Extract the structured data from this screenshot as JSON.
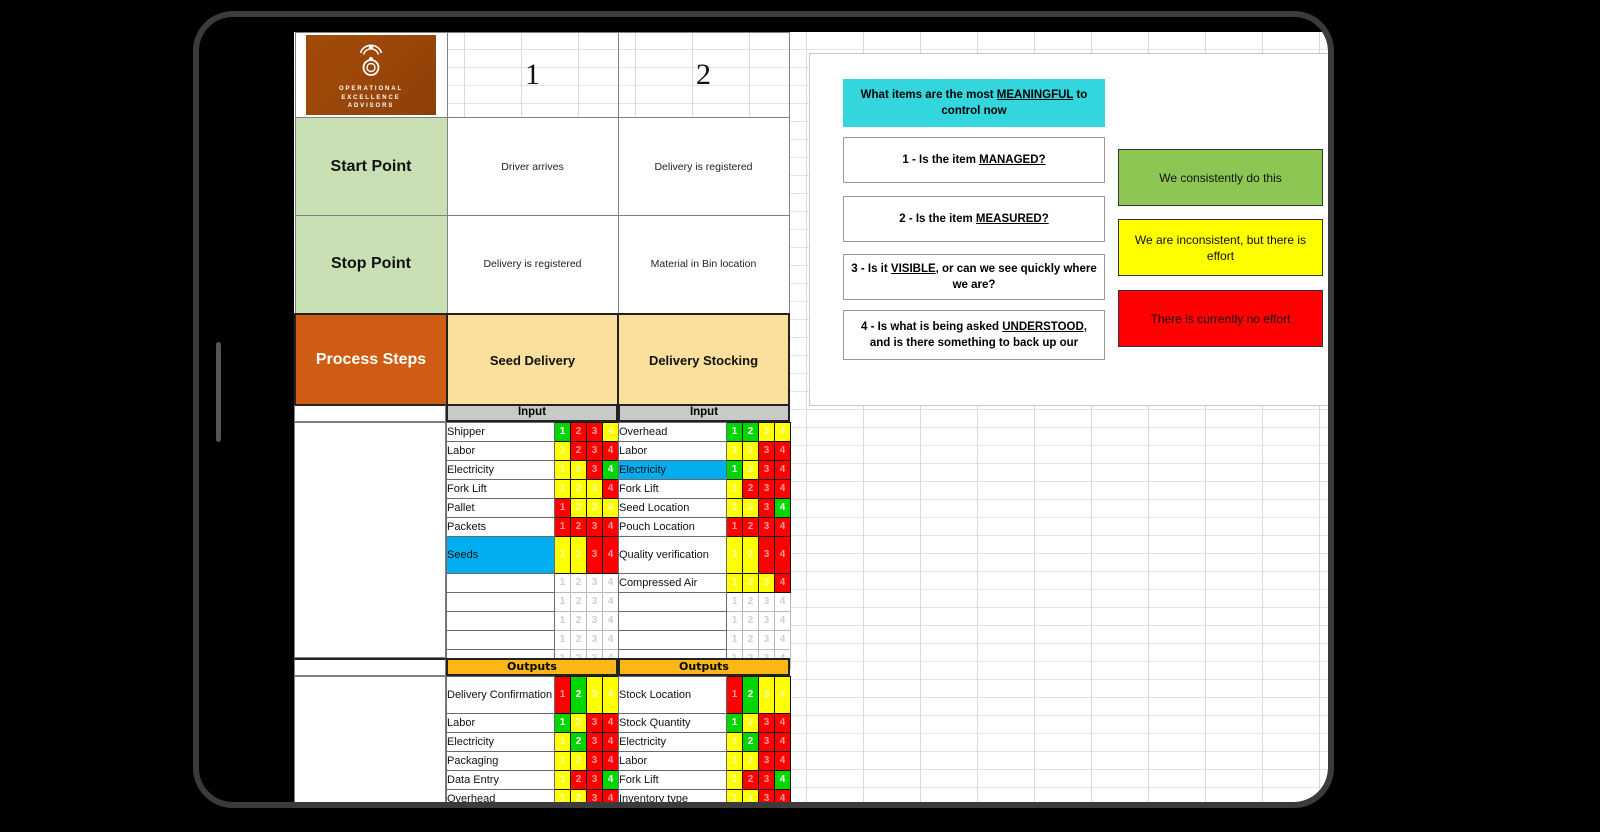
{
  "matrix": {
    "logo": {
      "line1": "OPERATIONAL",
      "line2": "EXCELLENCE",
      "line3": "ADVISORS",
      "icon": "concentric-circles-logo-icon",
      "bg_color": "#9b4709"
    },
    "column_numbers": [
      "1",
      "2"
    ],
    "rows": [
      {
        "label": "Start Point",
        "label_color": "#c9dfb4",
        "values": [
          "Driver arrives",
          "Delivery is registered"
        ]
      },
      {
        "label": "Stop Point",
        "label_color": "#c9dfb4",
        "values": [
          "Delivery is registered",
          "Material in Bin location"
        ]
      },
      {
        "label": "Process Steps",
        "label_color": "#ce5c12",
        "values": [
          "Seed Delivery",
          "Delivery Stocking"
        ]
      }
    ]
  },
  "sections": [
    {
      "header": "Input",
      "header_color": "#c9c9c9",
      "columns": [
        {
          "items": [
            {
              "name": "Shipper",
              "selected": false,
              "scores": [
                "g",
                "r",
                "r",
                "y"
              ]
            },
            {
              "name": "Labor",
              "selected": false,
              "scores": [
                "y",
                "r",
                "r",
                "r"
              ]
            },
            {
              "name": "Electricity",
              "selected": false,
              "scores": [
                "y",
                "y",
                "r",
                "g"
              ]
            },
            {
              "name": "Fork Lift",
              "selected": false,
              "scores": [
                "y",
                "y",
                "y",
                "r"
              ]
            },
            {
              "name": "Pallet",
              "selected": false,
              "scores": [
                "r",
                "y",
                "y",
                "y"
              ]
            },
            {
              "name": "Packets",
              "selected": false,
              "scores": [
                "r",
                "r",
                "r",
                "r"
              ]
            },
            {
              "name": "Seeds",
              "selected": true,
              "tall": true,
              "scores": [
                "y",
                "y",
                "r",
                "r"
              ]
            },
            {
              "name": "",
              "selected": false,
              "scores": [
                "n",
                "n",
                "n",
                "n"
              ]
            },
            {
              "name": "",
              "selected": false,
              "scores": [
                "n",
                "n",
                "n",
                "n"
              ]
            },
            {
              "name": "",
              "selected": false,
              "scores": [
                "n",
                "n",
                "n",
                "n"
              ]
            },
            {
              "name": "",
              "selected": false,
              "scores": [
                "n",
                "n",
                "n",
                "n"
              ]
            },
            {
              "name": "",
              "selected": false,
              "scores": [
                "n",
                "n",
                "n",
                "n"
              ]
            }
          ]
        },
        {
          "items": [
            {
              "name": "Overhead",
              "selected": false,
              "scores": [
                "g",
                "g",
                "y",
                "y"
              ]
            },
            {
              "name": "Labor",
              "selected": false,
              "scores": [
                "y",
                "y",
                "r",
                "r"
              ]
            },
            {
              "name": "Electricity",
              "selected": true,
              "scores": [
                "g",
                "y",
                "r",
                "r"
              ]
            },
            {
              "name": "Fork Lift",
              "selected": false,
              "scores": [
                "y",
                "r",
                "r",
                "r"
              ]
            },
            {
              "name": "Seed Location",
              "selected": false,
              "scores": [
                "y",
                "y",
                "r",
                "g"
              ]
            },
            {
              "name": "Pouch Location",
              "selected": false,
              "scores": [
                "r",
                "r",
                "r",
                "r"
              ]
            },
            {
              "name": "Quality verification",
              "selected": false,
              "tall": true,
              "scores": [
                "y",
                "y",
                "r",
                "r"
              ]
            },
            {
              "name": "Compressed Air",
              "selected": false,
              "scores": [
                "y",
                "y",
                "y",
                "r"
              ]
            },
            {
              "name": "",
              "selected": false,
              "scores": [
                "n",
                "n",
                "n",
                "n"
              ]
            },
            {
              "name": "",
              "selected": false,
              "scores": [
                "n",
                "n",
                "n",
                "n"
              ]
            },
            {
              "name": "",
              "selected": false,
              "scores": [
                "n",
                "n",
                "n",
                "n"
              ]
            },
            {
              "name": "",
              "selected": false,
              "scores": [
                "n",
                "n",
                "n",
                "n"
              ]
            }
          ]
        }
      ]
    },
    {
      "header": "Outputs",
      "header_color": "#fbb715",
      "columns": [
        {
          "items": [
            {
              "name": "Delivery Confirmation",
              "selected": false,
              "tall": true,
              "scores": [
                "r",
                "g",
                "y",
                "y"
              ]
            },
            {
              "name": "Labor",
              "selected": false,
              "scores": [
                "g",
                "y",
                "r",
                "r"
              ]
            },
            {
              "name": "Electricity",
              "selected": false,
              "scores": [
                "y",
                "g",
                "r",
                "r"
              ]
            },
            {
              "name": "Packaging",
              "selected": false,
              "scores": [
                "y",
                "y",
                "r",
                "r"
              ]
            },
            {
              "name": "Data Entry",
              "selected": false,
              "scores": [
                "y",
                "r",
                "r",
                "g"
              ]
            },
            {
              "name": "Overhead",
              "selected": false,
              "scores": [
                "y",
                "y",
                "r",
                "r"
              ]
            }
          ]
        },
        {
          "items": [
            {
              "name": "Stock Location",
              "selected": false,
              "tall": true,
              "scores": [
                "r",
                "g",
                "y",
                "y"
              ]
            },
            {
              "name": "Stock Quantity",
              "selected": false,
              "scores": [
                "g",
                "y",
                "r",
                "r"
              ]
            },
            {
              "name": "Electricity",
              "selected": false,
              "scores": [
                "y",
                "g",
                "r",
                "r"
              ]
            },
            {
              "name": "Labor",
              "selected": false,
              "scores": [
                "y",
                "y",
                "r",
                "r"
              ]
            },
            {
              "name": "Fork Lift",
              "selected": false,
              "scores": [
                "y",
                "r",
                "r",
                "g"
              ]
            },
            {
              "name": "Inventory type",
              "selected": false,
              "scores": [
                "y",
                "y",
                "r",
                "r"
              ]
            }
          ]
        }
      ]
    }
  ],
  "legend_panel": {
    "questions": [
      {
        "id": "q0",
        "prefix": "What items are the most ",
        "underline": "MEANINGFUL",
        "suffix": " to control now",
        "highlight": true,
        "color": "#33d6dd"
      },
      {
        "id": "q1",
        "prefix": "1 - Is the item ",
        "underline": "MANAGED?",
        "suffix": "",
        "highlight": false
      },
      {
        "id": "q2",
        "prefix": "2 - Is the item ",
        "underline": "MEASURED?",
        "suffix": "",
        "highlight": false
      },
      {
        "id": "q3",
        "prefix": "3 - Is it ",
        "underline": "VISIBLE",
        "suffix": ", or can we see quickly where we are?",
        "highlight": false
      },
      {
        "id": "q4",
        "prefix": "4 - Is what is being asked ",
        "underline": "UNDERSTOOD,",
        "suffix": " and is there something to back up our",
        "highlight": false
      }
    ],
    "scale": [
      {
        "id": "lg-green",
        "label": "We consistently do this",
        "color": "#8dc653"
      },
      {
        "id": "lg-yellow",
        "label": "We are inconsistent, but there is effort",
        "color": "#ffff00"
      },
      {
        "id": "lg-red",
        "label": "There is currently no effort",
        "color": "#fe0000"
      }
    ]
  },
  "score_digits": [
    "1",
    "2",
    "3",
    "4"
  ]
}
